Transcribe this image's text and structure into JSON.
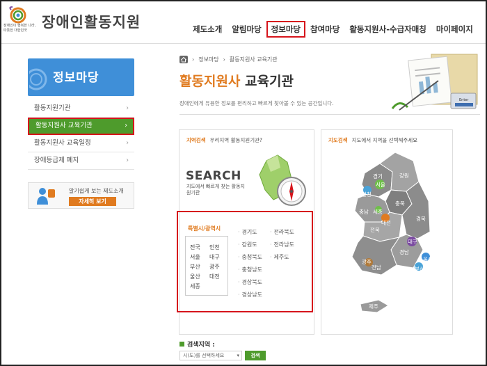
{
  "header": {
    "site_name": "장애인활동지원",
    "slogan_line1": "장애인이 행복한 나라,",
    "slogan_line2": "따뜻한 대한민국",
    "nav": [
      "제도소개",
      "알림마당",
      "정보마당",
      "참여마당",
      "활동지원사-수급자매칭",
      "마이페이지"
    ],
    "active_nav_index": 2
  },
  "sidebar": {
    "banner_title": "정보마당",
    "items": [
      {
        "label": "활동지원기관"
      },
      {
        "label": "활동지원사 교육기관"
      },
      {
        "label": "활동지원사 교육일정"
      },
      {
        "label": "장애등급제 폐지"
      }
    ],
    "arrow": "›",
    "active_index": 1,
    "ad": {
      "text": "알기쉽게 보는 제도소개",
      "button": "자세히 보기"
    }
  },
  "main": {
    "breadcrumb": [
      "정보마당",
      "활동지원사 교육기관"
    ],
    "title_highlight": "활동지원사",
    "title_rest": " 교육기관",
    "description": "장애인에게 유용한 정보를 편리하고 빠르게 찾아볼 수 있는 공간입니다.",
    "enter_label": "Enter"
  },
  "region_search": {
    "header_bold": "지역검색",
    "header_text": "우리지역 활동지원기관?",
    "big_text": "SEARCH",
    "sub_text": "지도에서 빠르게 찾는 활동지원기관",
    "metro_label": "특별시/광역시",
    "metro_cities": [
      "전국",
      "인천",
      "서울",
      "대구",
      "부산",
      "광주",
      "울산",
      "대전",
      "세종"
    ],
    "provinces_col1": [
      "경기도",
      "강원도",
      "충청북도",
      "충청남도",
      "경상북도",
      "경상남도"
    ],
    "provinces_col2": [
      "전라북도",
      "전라남도",
      "제주도"
    ]
  },
  "map_search": {
    "header_bold": "지도검색",
    "header_text": "지도에서 지역을 선택해주세요",
    "regions": [
      "경기",
      "강원",
      "서울",
      "인천",
      "충북",
      "충남",
      "세종",
      "대전",
      "경북",
      "전북",
      "대구",
      "경남",
      "울산",
      "광주",
      "부산",
      "전남",
      "제주"
    ]
  },
  "search_bar": {
    "label": "검색지역 :",
    "select_placeholder": "시(도)를 선택하세요",
    "button": "검색"
  },
  "colors": {
    "accent_orange": "#e07b20",
    "accent_green": "#4e9b2c",
    "highlight_red": "#d6141b",
    "banner_blue": "#3f8fd8"
  }
}
